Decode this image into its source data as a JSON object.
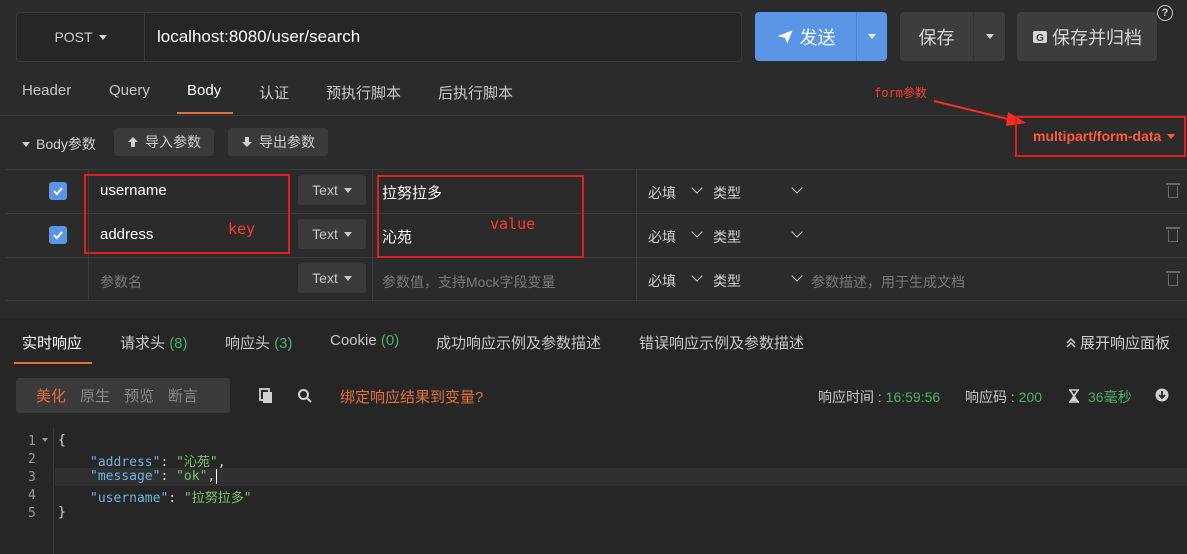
{
  "request": {
    "method": "POST",
    "url": "localhost:8080/user/search",
    "send_label": "发送",
    "save_label": "保存",
    "save_archive_label": "保存并归档",
    "help": "?"
  },
  "req_tabs": [
    "Header",
    "Query",
    "Body",
    "认证",
    "预执行脚本",
    "后执行脚本"
  ],
  "body": {
    "section_label": "Body参数",
    "import_label": "导入参数",
    "export_label": "导出参数",
    "content_type": "multipart/form-data",
    "rows": [
      {
        "checked": true,
        "name": "username",
        "type": "Text",
        "value": "拉努拉多",
        "required": "必填",
        "type_select": "类型",
        "desc": ""
      },
      {
        "checked": true,
        "name": "address",
        "type": "Text",
        "value": "沁苑",
        "required": "必填",
        "type_select": "类型",
        "desc": ""
      },
      {
        "checked": false,
        "name": "",
        "type": "Text",
        "value": "",
        "required": "必填",
        "type_select": "类型",
        "desc": ""
      }
    ],
    "name_placeholder": "参数名",
    "value_placeholder": "参数值，支持Mock字段变量",
    "desc_placeholder": "参数描述，用于生成文档"
  },
  "annotations": {
    "form_params": "form参数",
    "key": "key",
    "value": "value"
  },
  "resp_tabs": {
    "realtime": "实时响应",
    "request_headers": "请求头",
    "request_headers_count": "(8)",
    "response_headers": "响应头",
    "response_headers_count": "(3)",
    "cookie": "Cookie",
    "cookie_count": "(0)",
    "success_examples": "成功响应示例及参数描述",
    "error_examples": "错误响应示例及参数描述",
    "expand": "展开响应面板"
  },
  "resp_toolbar": {
    "modes": [
      "美化",
      "原生",
      "预览",
      "断言"
    ],
    "bind_link": "绑定响应结果到变量?",
    "time_label": "响应时间 : ",
    "time_value": "16:59:56",
    "code_label": "响应码 : ",
    "code_value": "200",
    "duration": "36毫秒"
  },
  "code": {
    "line_numbers": [
      "1",
      "2",
      "3",
      "4",
      "5"
    ],
    "open": "{",
    "address_key": "\"address\"",
    "address_val": "\"沁苑\"",
    "message_key": "\"message\"",
    "message_val": "\"ok\"",
    "username_key": "\"username\"",
    "username_val": "\"拉努拉多\"",
    "close": "}"
  }
}
